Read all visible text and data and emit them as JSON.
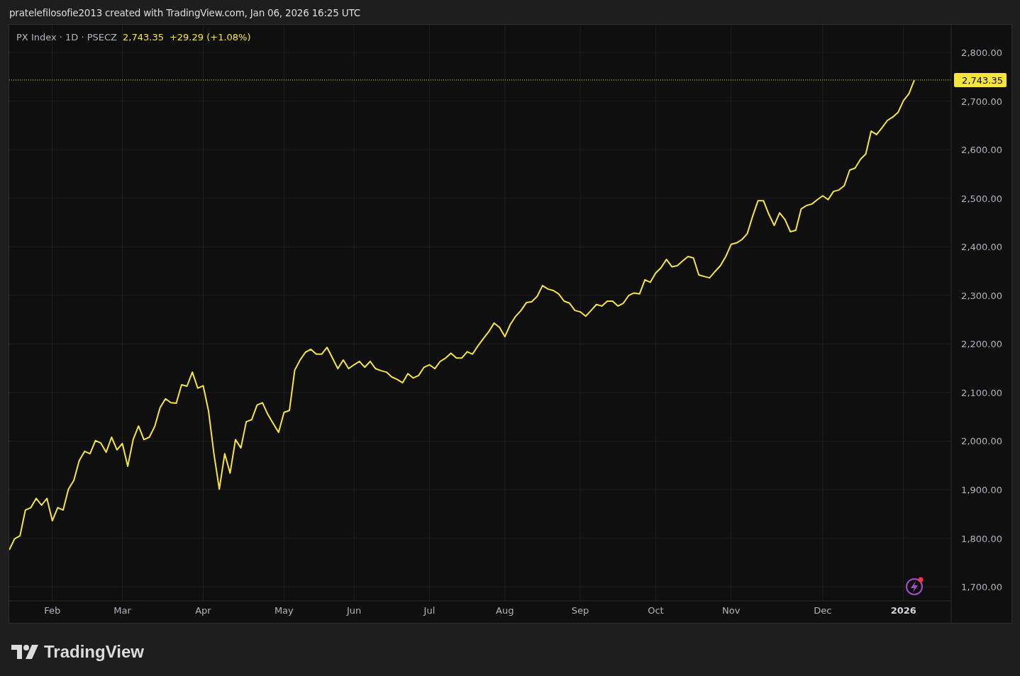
{
  "credit": "pratelefilosofie2013 created with TradingView.com, Jan 06, 2026 16:25 UTC",
  "legend": {
    "symbol": "PX Index · 1D · PSECZ",
    "price": "2,743.35",
    "change": "+29.29 (+1.08%)"
  },
  "chart_data": {
    "type": "line",
    "grid": true,
    "ref_lines": [
      {
        "axis": "y",
        "value": 2743.35,
        "label": "2,743.35",
        "color": "#f7e53b"
      }
    ],
    "ylim": [
      1671,
      2857
    ],
    "yticks": [
      {
        "value": 1700,
        "label": "1,700.00"
      },
      {
        "value": 1800,
        "label": "1,800.00"
      },
      {
        "value": 1900,
        "label": "1,900.00"
      },
      {
        "value": 2000,
        "label": "2,000.00"
      },
      {
        "value": 2100,
        "label": "2,100.00"
      },
      {
        "value": 2200,
        "label": "2,200.00"
      },
      {
        "value": 2300,
        "label": "2,300.00"
      },
      {
        "value": 2400,
        "label": "2,400.00"
      },
      {
        "value": 2500,
        "label": "2,500.00"
      },
      {
        "value": 2600,
        "label": "2,600.00"
      },
      {
        "value": 2700,
        "label": "2,700.00"
      },
      {
        "value": 2800,
        "label": "2,800.00"
      }
    ],
    "categories": [
      null,
      null,
      null,
      null,
      null,
      null,
      null,
      null,
      "Feb",
      null,
      null,
      null,
      null,
      null,
      null,
      null,
      null,
      null,
      null,
      null,
      null,
      "Mar",
      null,
      null,
      null,
      null,
      null,
      null,
      null,
      null,
      null,
      null,
      null,
      null,
      null,
      null,
      "Apr",
      null,
      null,
      null,
      null,
      null,
      null,
      null,
      null,
      null,
      null,
      null,
      null,
      null,
      null,
      "May",
      null,
      null,
      null,
      null,
      null,
      null,
      null,
      null,
      null,
      null,
      null,
      null,
      "Jun",
      null,
      null,
      null,
      null,
      null,
      null,
      null,
      null,
      null,
      null,
      null,
      null,
      null,
      "Jul",
      null,
      null,
      null,
      null,
      null,
      null,
      null,
      null,
      null,
      null,
      null,
      null,
      null,
      "Aug",
      null,
      null,
      null,
      null,
      null,
      null,
      null,
      null,
      null,
      null,
      null,
      null,
      null,
      "Sep",
      null,
      null,
      null,
      null,
      null,
      null,
      null,
      null,
      null,
      null,
      null,
      null,
      null,
      "Oct",
      null,
      null,
      null,
      null,
      null,
      null,
      null,
      null,
      null,
      null,
      null,
      null,
      null,
      "Nov",
      null,
      null,
      null,
      null,
      null,
      null,
      null,
      null,
      null,
      null,
      null,
      null,
      null,
      null,
      null,
      null,
      "Dec",
      null,
      null,
      null,
      null,
      null,
      null,
      null,
      null,
      null,
      null,
      null,
      null,
      null,
      null,
      "2026",
      null,
      null
    ],
    "series": [
      {
        "color": "#f7e53b",
        "values": [
          1776,
          1799,
          1805,
          1858,
          1863,
          1882,
          1868,
          1882,
          1836,
          1863,
          1858,
          1901,
          1919,
          1960,
          1979,
          1974,
          2001,
          1996,
          1977,
          2008,
          1982,
          1995,
          1948,
          2003,
          2031,
          2003,
          2008,
          2030,
          2069,
          2087,
          2079,
          2078,
          2116,
          2113,
          2142,
          2109,
          2114,
          2062,
          1974,
          1901,
          1974,
          1934,
          2003,
          1986,
          2040,
          2044,
          2074,
          2079,
          2055,
          2036,
          2018,
          2059,
          2063,
          2146,
          2167,
          2183,
          2189,
          2179,
          2179,
          2193,
          2171,
          2149,
          2167,
          2149,
          2157,
          2164,
          2152,
          2164,
          2149,
          2145,
          2142,
          2132,
          2127,
          2120,
          2139,
          2130,
          2135,
          2152,
          2157,
          2149,
          2164,
          2171,
          2181,
          2171,
          2171,
          2184,
          2179,
          2196,
          2211,
          2225,
          2243,
          2234,
          2215,
          2240,
          2257,
          2269,
          2285,
          2287,
          2298,
          2320,
          2313,
          2310,
          2303,
          2288,
          2284,
          2269,
          2266,
          2257,
          2269,
          2281,
          2278,
          2288,
          2288,
          2278,
          2284,
          2300,
          2305,
          2303,
          2332,
          2327,
          2346,
          2357,
          2374,
          2359,
          2361,
          2371,
          2380,
          2377,
          2342,
          2339,
          2336,
          2349,
          2361,
          2380,
          2405,
          2408,
          2415,
          2427,
          2463,
          2495,
          2495,
          2467,
          2444,
          2470,
          2456,
          2431,
          2434,
          2478,
          2485,
          2488,
          2497,
          2505,
          2497,
          2514,
          2517,
          2526,
          2558,
          2562,
          2580,
          2591,
          2638,
          2631,
          2645,
          2660,
          2667,
          2677,
          2701,
          2715,
          2743
        ]
      }
    ]
  },
  "footer": {
    "logo_text": "TradingView"
  }
}
